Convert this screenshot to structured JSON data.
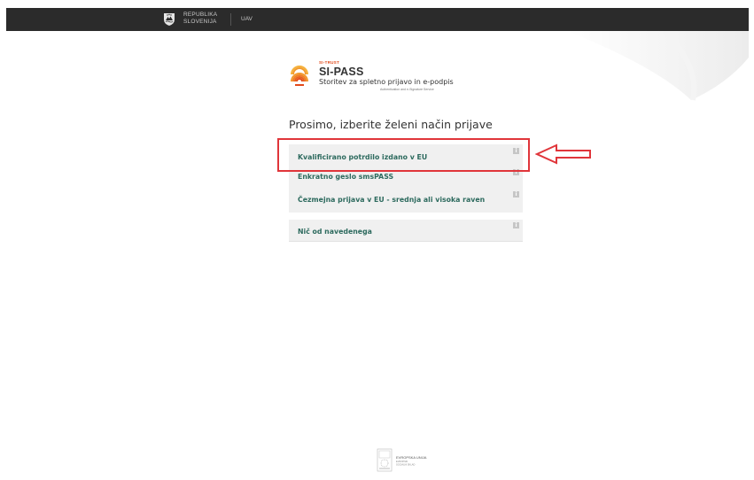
{
  "topbar": {
    "gov_line1": "REPUBLIKA",
    "gov_line2": "SLOVENIJA",
    "unit": "UAV"
  },
  "logo": {
    "brand_small": "SI-TRUST",
    "name": "SI-PASS",
    "tagline": "Storitev za spletno prijavo in e-podpis",
    "subtagline": "Authentication and e-Signature Service"
  },
  "heading": "Prosimo, izberite želeni način prijave",
  "options": [
    {
      "label": "Kvalificirano potrdilo izdano v EU",
      "info": "i"
    },
    {
      "label": "Enkratno geslo smsPASS",
      "info": "i"
    },
    {
      "label": "Čezmejna prijava v EU - srednja ali visoka raven",
      "info": "i"
    },
    {
      "label": "Nič od navedenega",
      "info": "i"
    }
  ],
  "footer": {
    "eu_line1": "EVROPSKA UNIJA",
    "eu_line2": "EVROPSKI",
    "eu_line3": "SOCIALNI SKLAD"
  },
  "colors": {
    "topbar": "#2b2b2b",
    "option_text": "#2d6a5e",
    "option_bg": "#f0f0f0",
    "highlight": "#e0353a",
    "brand_orange": "#e24a1b"
  },
  "icons": [
    "slovenia-crest-icon",
    "si-pass-logo-icon",
    "info-icon",
    "arrow-left-icon",
    "eu-flag-icon"
  ]
}
